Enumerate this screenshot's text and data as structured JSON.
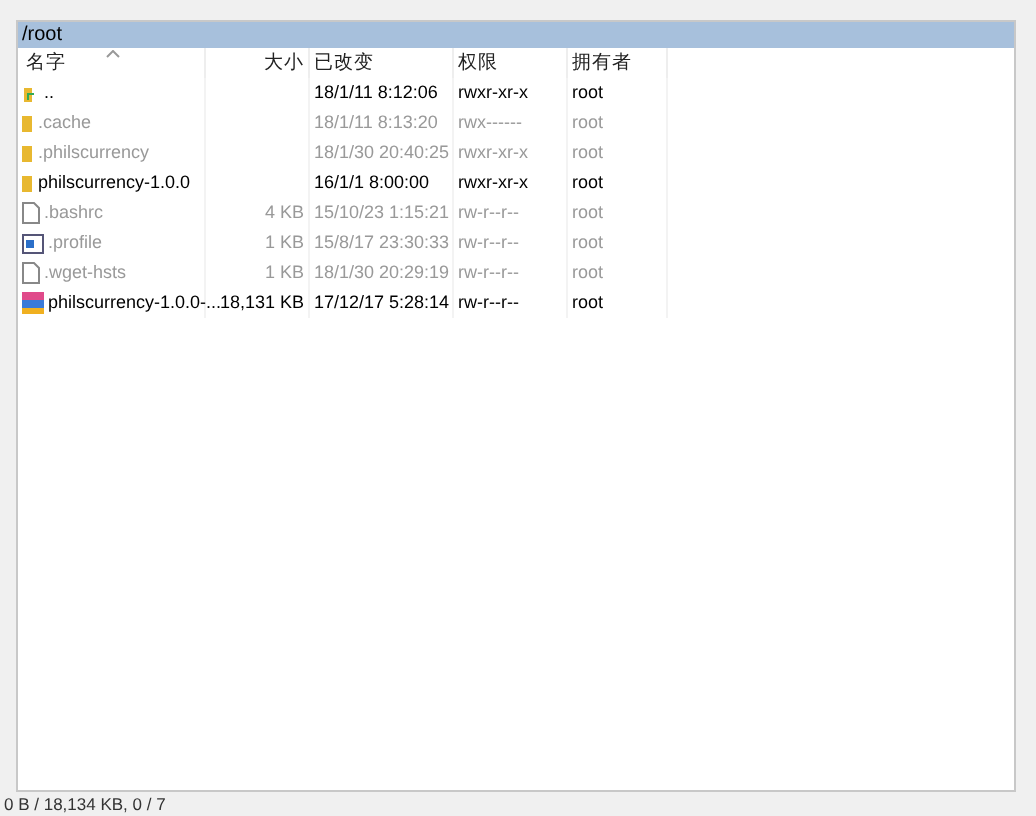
{
  "path_bar": {
    "title": "/root"
  },
  "table": {
    "columns": [
      {
        "label": "名字",
        "sorted": true
      },
      {
        "label": "大小",
        "sorted": false
      },
      {
        "label": "已改变",
        "sorted": false
      },
      {
        "label": "权限",
        "sorted": false
      },
      {
        "label": "拥有者",
        "sorted": false
      }
    ],
    "rows": [
      {
        "kind": "parent",
        "name": "..",
        "size": "",
        "modified": "18/1/11 8:12:06",
        "permissions": "rwxr-xr-x",
        "owner": "root",
        "hidden": false
      },
      {
        "kind": "folder",
        "name": ".cache",
        "size": "",
        "modified": "18/1/11 8:13:20",
        "permissions": "rwx------",
        "owner": "root",
        "hidden": true
      },
      {
        "kind": "folder",
        "name": ".philscurrency",
        "size": "",
        "modified": "18/1/30 20:40:25",
        "permissions": "rwxr-xr-x",
        "owner": "root",
        "hidden": true
      },
      {
        "kind": "folder",
        "name": "philscurrency-1.0.0",
        "size": "",
        "modified": "16/1/1 8:00:00",
        "permissions": "rwxr-xr-x",
        "owner": "root",
        "hidden": false
      },
      {
        "kind": "file",
        "name": ".bashrc",
        "size": "4 KB",
        "modified": "15/10/23 1:15:21",
        "permissions": "rw-r--r--",
        "owner": "root",
        "hidden": true
      },
      {
        "kind": "config",
        "name": ".profile",
        "size": "1 KB",
        "modified": "15/8/17 23:30:33",
        "permissions": "rw-r--r--",
        "owner": "root",
        "hidden": true
      },
      {
        "kind": "file",
        "name": ".wget-hsts",
        "size": "1 KB",
        "modified": "18/1/30 20:29:19",
        "permissions": "rw-r--r--",
        "owner": "root",
        "hidden": true
      },
      {
        "kind": "archive",
        "name": "philscurrency-1.0.0-...",
        "size": "18,131 KB",
        "modified": "17/12/17 5:28:14",
        "permissions": "rw-r--r--",
        "owner": "root",
        "hidden": false
      }
    ]
  },
  "status_bar": {
    "text": "0 B / 18,134 KB,   0 / 7"
  }
}
